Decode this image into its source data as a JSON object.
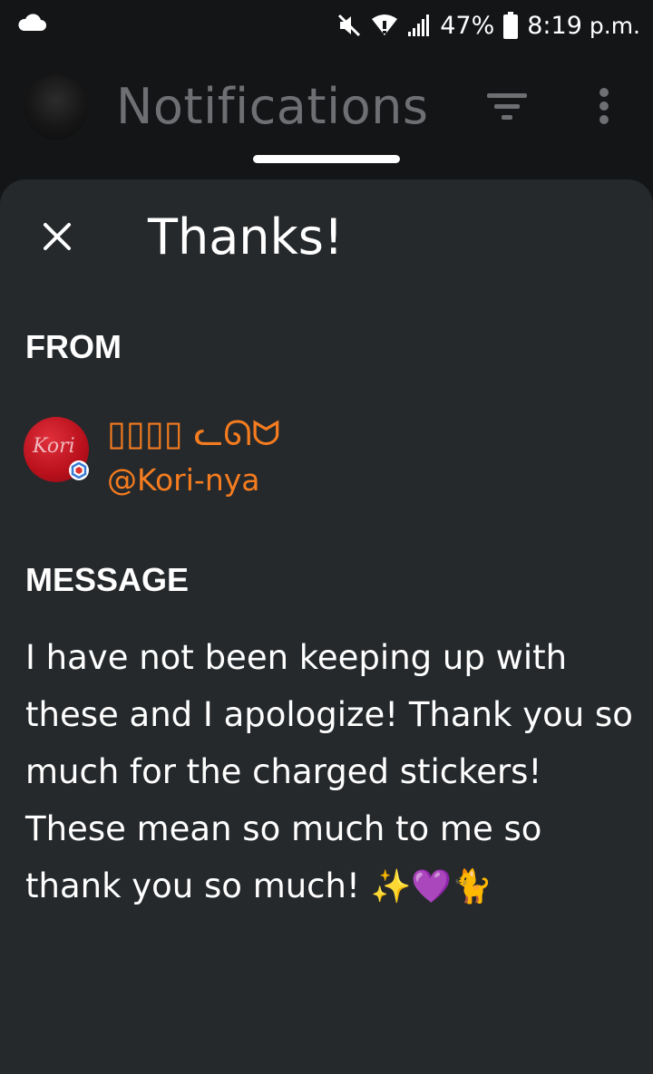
{
  "status_bar": {
    "battery_percent": "47%",
    "time": "8:19",
    "ampm": "p.m."
  },
  "header": {
    "title": "Notifications"
  },
  "dialog": {
    "title": "Thanks!",
    "from_label": "FROM",
    "sender": {
      "display_name": "▯▯▯▯ ᓚᘏᗢ",
      "handle": "@Kori-nya",
      "avatar_text": "Kori",
      "name_color": "#f57c1f"
    },
    "message_label": "MESSAGE",
    "message_text": "I have not been keeping up with these and I apologize! Thank you so much for the charged stickers! These mean so much to me so thank you so much!",
    "message_emojis": [
      "✨",
      "💜",
      "🐈"
    ]
  },
  "colors": {
    "background": "#141517",
    "sheet": "#26292c",
    "accent": "#f57c1f",
    "header_text": "#6d6f73"
  }
}
